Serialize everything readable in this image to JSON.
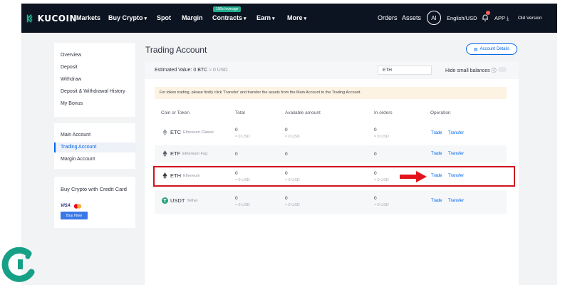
{
  "nav": {
    "logo": "KUCOIN",
    "items": [
      {
        "label": "Markets",
        "caret": false
      },
      {
        "label": "Buy Crypto",
        "caret": true
      },
      {
        "label": "Spot",
        "caret": false
      },
      {
        "label": "Margin",
        "caret": false
      },
      {
        "label": "Contracts",
        "caret": true,
        "badge": "100x leverage"
      },
      {
        "label": "Earn",
        "caret": true
      },
      {
        "label": "More",
        "caret": true
      }
    ],
    "right": {
      "orders": "Orders",
      "assets": "Assets",
      "avatar": "AI",
      "lang": "English/USD",
      "app": "APP",
      "old_version": "Old Version"
    }
  },
  "sidebar": {
    "group1": [
      "Overview",
      "Deposit",
      "Withdraw",
      "Deposit & Withdrawal History",
      "My Bonus"
    ],
    "group2": [
      "Main Account",
      "Trading Account",
      "Margin Account"
    ],
    "active": "Trading Account",
    "promo": {
      "title": "Buy Crypto with Credit Card",
      "visa": "VISA",
      "button": "Buy Now"
    }
  },
  "main": {
    "title": "Trading Account",
    "details_button": "Account Details",
    "estimated_label": "Estimated Value:",
    "estimated_btc": "0 BTC",
    "estimated_usd": "≈ 0 USD",
    "search_value": "ETH",
    "hide_small": "Hide small balances",
    "notice": "For token trading, please firstly click 'Transfer' and transfer the assets from the Main Account to the Trading Account.",
    "columns": [
      "Coin or Token",
      "Total",
      "Available amount",
      "In orders",
      "Operation"
    ],
    "rows": [
      {
        "symbol": "ETC",
        "name": "Ethereum Classic",
        "total": "0",
        "total_usd": "≈ 0 USD",
        "available": "0",
        "available_usd": "≈ 0 USD",
        "in_orders": "0",
        "in_orders_usd": "≈ 0 USD",
        "trade": "Trade",
        "transfer": "Transfer"
      },
      {
        "symbol": "ETF",
        "name": "Ethereum Fog",
        "total": "0",
        "total_usd": "",
        "available": "0",
        "available_usd": "",
        "in_orders": "0",
        "in_orders_usd": "",
        "trade": "Trade",
        "transfer": "Transfer"
      },
      {
        "symbol": "ETH",
        "name": "Ethereum",
        "total": "0",
        "total_usd": "≈ 0 USD",
        "available": "0",
        "available_usd": "≈ 0 USD",
        "in_orders": "0",
        "in_orders_usd": "≈ 0 USD",
        "trade": "Trade",
        "transfer": "Transfer"
      },
      {
        "symbol": "USDT",
        "name": "Tether",
        "total": "0",
        "total_usd": "≈ 0 USD",
        "available": "0",
        "available_usd": "≈ 0 USD",
        "in_orders": "0",
        "in_orders_usd": "≈ 0 USD",
        "trade": "Trade",
        "transfer": "Transfer"
      }
    ]
  },
  "colors": {
    "nav_bg": "#0d1421",
    "accent": "#0066ed",
    "highlight": "#d0141d",
    "tether": "#26a17b"
  }
}
